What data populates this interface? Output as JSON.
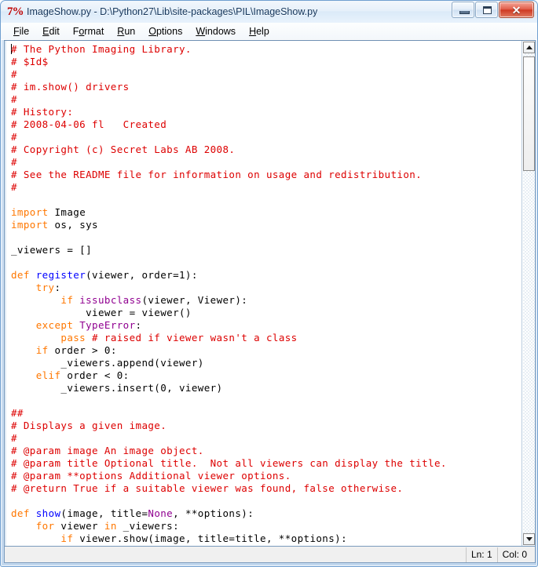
{
  "window": {
    "title": "ImageShow.py - D:\\Python27\\Lib\\site-packages\\PIL\\ImageShow.py",
    "app_icon_glyph": "7%",
    "controls": {
      "minimize": "–",
      "maximize": "□",
      "close": "✕"
    }
  },
  "menubar": {
    "items": [
      {
        "acc": "F",
        "rest": "ile"
      },
      {
        "acc": "E",
        "rest": "dit"
      },
      {
        "pre": "F",
        "acc": "o",
        "rest": "rmat"
      },
      {
        "acc": "R",
        "rest": "un"
      },
      {
        "acc": "O",
        "rest": "ptions"
      },
      {
        "acc": "W",
        "rest": "indows"
      },
      {
        "acc": "H",
        "rest": "elp"
      }
    ]
  },
  "editor": {
    "lines": [
      [
        {
          "t": "# The Python Imaging Library.",
          "c": "cm"
        }
      ],
      [
        {
          "t": "# $Id$",
          "c": "cm"
        }
      ],
      [
        {
          "t": "#",
          "c": "cm"
        }
      ],
      [
        {
          "t": "# im.show() drivers",
          "c": "cm"
        }
      ],
      [
        {
          "t": "#",
          "c": "cm"
        }
      ],
      [
        {
          "t": "# History:",
          "c": "cm"
        }
      ],
      [
        {
          "t": "# 2008-04-06 fl   Created",
          "c": "cm"
        }
      ],
      [
        {
          "t": "#",
          "c": "cm"
        }
      ],
      [
        {
          "t": "# Copyright (c) Secret Labs AB 2008.",
          "c": "cm"
        }
      ],
      [
        {
          "t": "#",
          "c": "cm"
        }
      ],
      [
        {
          "t": "# See the README file for information on usage and redistribution.",
          "c": "cm"
        }
      ],
      [
        {
          "t": "#",
          "c": "cm"
        }
      ],
      [
        {
          "t": "",
          "c": "pl"
        }
      ],
      [
        {
          "t": "import",
          "c": "kw"
        },
        {
          "t": " Image",
          "c": "pl"
        }
      ],
      [
        {
          "t": "import",
          "c": "kw"
        },
        {
          "t": " os, sys",
          "c": "pl"
        }
      ],
      [
        {
          "t": "",
          "c": "pl"
        }
      ],
      [
        {
          "t": "_viewers = []",
          "c": "pl"
        }
      ],
      [
        {
          "t": "",
          "c": "pl"
        }
      ],
      [
        {
          "t": "def",
          "c": "kw"
        },
        {
          "t": " ",
          "c": "pl"
        },
        {
          "t": "register",
          "c": "fn"
        },
        {
          "t": "(viewer, order=1):",
          "c": "pl"
        }
      ],
      [
        {
          "t": "    ",
          "c": "pl"
        },
        {
          "t": "try",
          "c": "kw"
        },
        {
          "t": ":",
          "c": "pl"
        }
      ],
      [
        {
          "t": "        ",
          "c": "pl"
        },
        {
          "t": "if",
          "c": "kw"
        },
        {
          "t": " ",
          "c": "pl"
        },
        {
          "t": "issubclass",
          "c": "bi"
        },
        {
          "t": "(viewer, Viewer):",
          "c": "pl"
        }
      ],
      [
        {
          "t": "            viewer = viewer()",
          "c": "pl"
        }
      ],
      [
        {
          "t": "    ",
          "c": "pl"
        },
        {
          "t": "except",
          "c": "kw"
        },
        {
          "t": " ",
          "c": "pl"
        },
        {
          "t": "TypeError",
          "c": "bi"
        },
        {
          "t": ":",
          "c": "pl"
        }
      ],
      [
        {
          "t": "        ",
          "c": "pl"
        },
        {
          "t": "pass",
          "c": "kw"
        },
        {
          "t": " ",
          "c": "pl"
        },
        {
          "t": "# raised if viewer wasn't a class",
          "c": "cm"
        }
      ],
      [
        {
          "t": "    ",
          "c": "pl"
        },
        {
          "t": "if",
          "c": "kw"
        },
        {
          "t": " order > 0:",
          "c": "pl"
        }
      ],
      [
        {
          "t": "        _viewers.append(viewer)",
          "c": "pl"
        }
      ],
      [
        {
          "t": "    ",
          "c": "pl"
        },
        {
          "t": "elif",
          "c": "kw"
        },
        {
          "t": " order < 0:",
          "c": "pl"
        }
      ],
      [
        {
          "t": "        _viewers.insert(0, viewer)",
          "c": "pl"
        }
      ],
      [
        {
          "t": "",
          "c": "pl"
        }
      ],
      [
        {
          "t": "##",
          "c": "cm"
        }
      ],
      [
        {
          "t": "# Displays a given image.",
          "c": "cm"
        }
      ],
      [
        {
          "t": "#",
          "c": "cm"
        }
      ],
      [
        {
          "t": "# @param image An image object.",
          "c": "cm"
        }
      ],
      [
        {
          "t": "# @param title Optional title.  Not all viewers can display the title.",
          "c": "cm"
        }
      ],
      [
        {
          "t": "# @param **options Additional viewer options.",
          "c": "cm"
        }
      ],
      [
        {
          "t": "# @return True if a suitable viewer was found, false otherwise.",
          "c": "cm"
        }
      ],
      [
        {
          "t": "",
          "c": "pl"
        }
      ],
      [
        {
          "t": "def",
          "c": "kw"
        },
        {
          "t": " ",
          "c": "pl"
        },
        {
          "t": "show",
          "c": "fn"
        },
        {
          "t": "(image, title=",
          "c": "pl"
        },
        {
          "t": "None",
          "c": "bi"
        },
        {
          "t": ", **options):",
          "c": "pl"
        }
      ],
      [
        {
          "t": "    ",
          "c": "pl"
        },
        {
          "t": "for",
          "c": "kw"
        },
        {
          "t": " viewer ",
          "c": "pl"
        },
        {
          "t": "in",
          "c": "kw"
        },
        {
          "t": " _viewers:",
          "c": "pl"
        }
      ],
      [
        {
          "t": "        ",
          "c": "pl"
        },
        {
          "t": "if",
          "c": "kw"
        },
        {
          "t": " viewer.show(image, title=title, **options):",
          "c": "pl"
        }
      ]
    ]
  },
  "scrollbar": {
    "up_arrow": "▲",
    "down_arrow": "▼"
  },
  "statusbar": {
    "line": "Ln: 1",
    "column": "Col: 0"
  },
  "colors": {
    "comment": "#dd0000",
    "keyword": "#ff7700",
    "definition": "#0000ff",
    "builtin": "#900090",
    "plain": "#000000",
    "editor_background": "#ffffff",
    "frame": "#cfe0f2",
    "close_button": "#cf3a23"
  }
}
